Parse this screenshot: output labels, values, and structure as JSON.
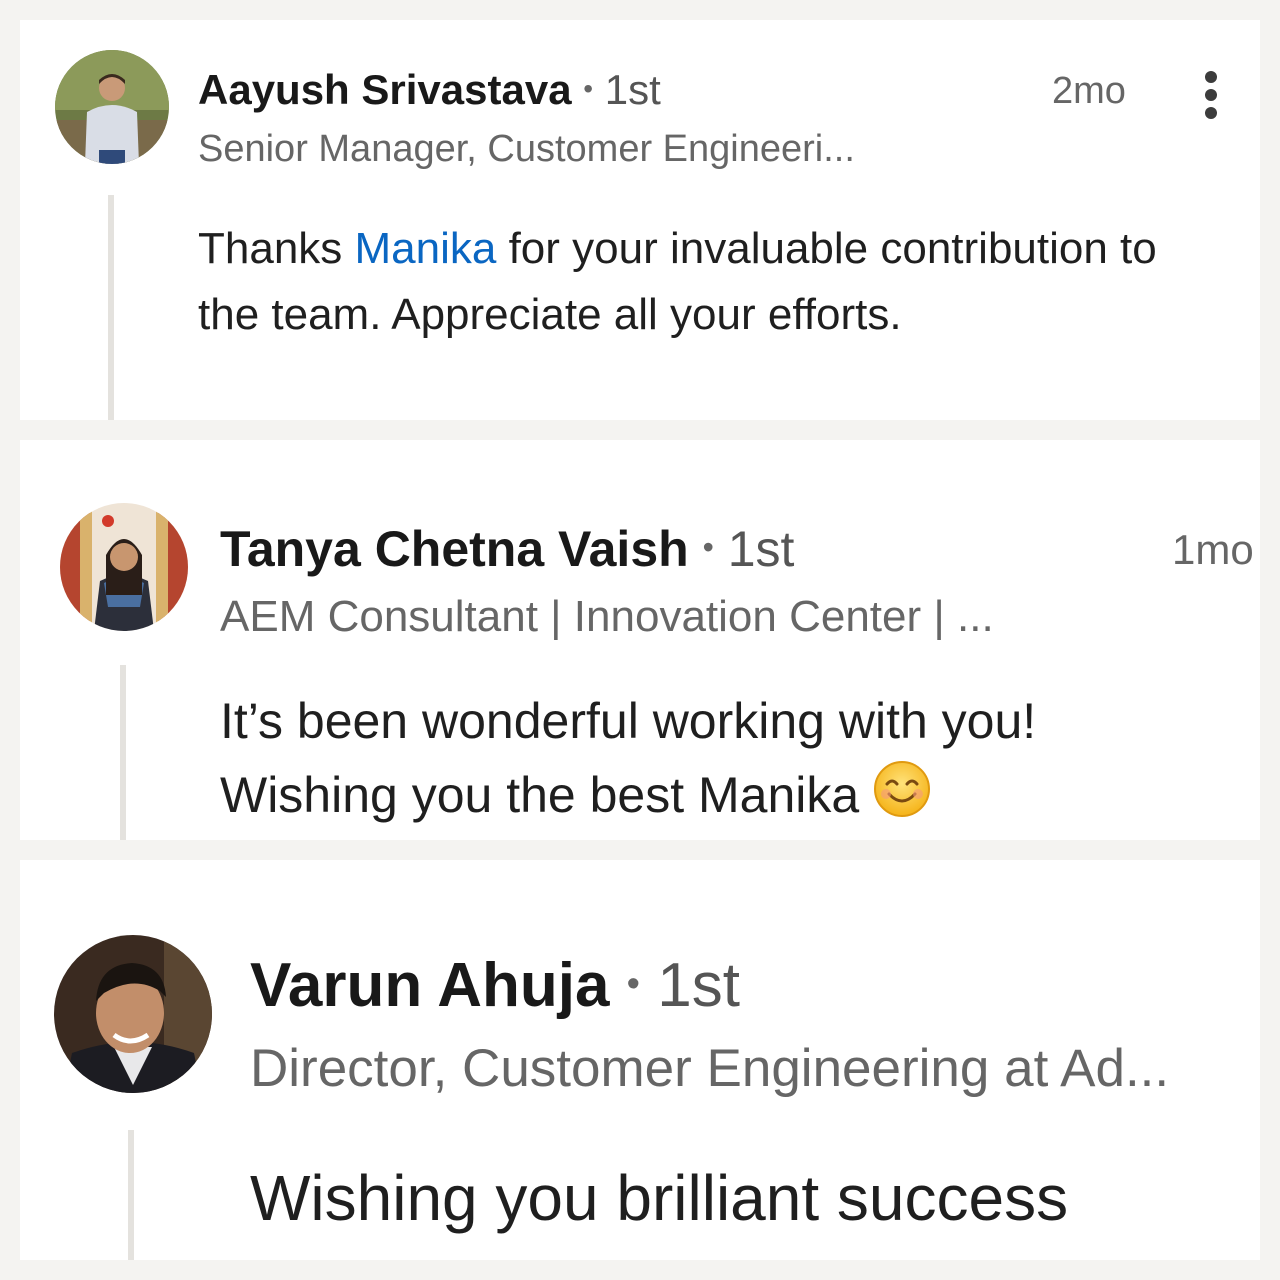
{
  "comments": [
    {
      "author": "Aayush Srivastava",
      "separator": "•",
      "degree": "1st",
      "headline": "Senior Manager, Customer Engineeri...",
      "time": "2mo",
      "text_before": "Thanks ",
      "mention": "Manika",
      "text_after": " for your invaluable contribution to the team. Appreciate all your efforts."
    },
    {
      "author": "Tanya Chetna Vaish",
      "separator": "•",
      "degree": "1st",
      "headline": "AEM Consultant | Innovation Center | ...",
      "time": "1mo",
      "text": "It’s been wonderful working with you! Wishing you the best Manika",
      "emoji": "smiling-face-icon"
    },
    {
      "author": "Varun Ahuja",
      "separator": "•",
      "degree": "1st",
      "headline": "Director, Customer Engineering at Ad...",
      "text": "Wishing you brilliant success"
    }
  ],
  "icons": {
    "more": "vertical-ellipsis-icon"
  },
  "colors": {
    "mention": "#0a66c2",
    "background": "#f4f3f1",
    "card": "#ffffff",
    "thread_line": "#e4e2de"
  }
}
